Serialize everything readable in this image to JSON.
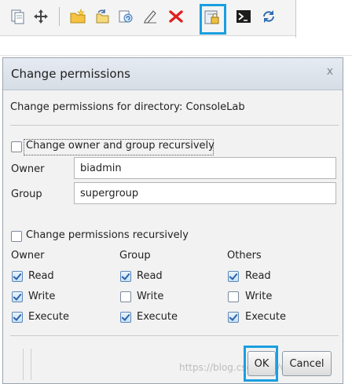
{
  "toolbar": {
    "icons": [
      "copy-icon",
      "move-icon",
      "new-folder-icon",
      "rename-icon",
      "refresh-folder-icon",
      "edit-icon",
      "delete-icon",
      "permissions-icon",
      "terminal-icon",
      "reload-icon"
    ],
    "highlight_color": "#1a9fe0"
  },
  "dialog": {
    "title": "Change permissions",
    "close_symbol": "x",
    "heading": "Change permissions for directory: ConsoleLab",
    "owner_group_recursive": {
      "label": "Change owner and group recursively",
      "checked": false
    },
    "owner": {
      "label": "Owner",
      "value": "biadmin"
    },
    "group": {
      "label": "Group",
      "value": "supergroup"
    },
    "permissions_recursive": {
      "label": "Change permissions recursively",
      "checked": false
    },
    "columns": [
      {
        "header": "Owner",
        "read": "Read",
        "write": "Write",
        "execute": "Execute",
        "read_checked": true,
        "write_checked": true,
        "execute_checked": true
      },
      {
        "header": "Group",
        "read": "Read",
        "write": "Write",
        "execute": "Execute",
        "read_checked": true,
        "write_checked": false,
        "execute_checked": true
      },
      {
        "header": "Others",
        "read": "Read",
        "write": "Write",
        "execute": "Execute",
        "read_checked": true,
        "write_checked": false,
        "execute_checked": true
      }
    ],
    "ok_label": "OK",
    "cancel_label": "Cancel"
  },
  "watermark": "https://blog.csdn.net/weixin_4..."
}
